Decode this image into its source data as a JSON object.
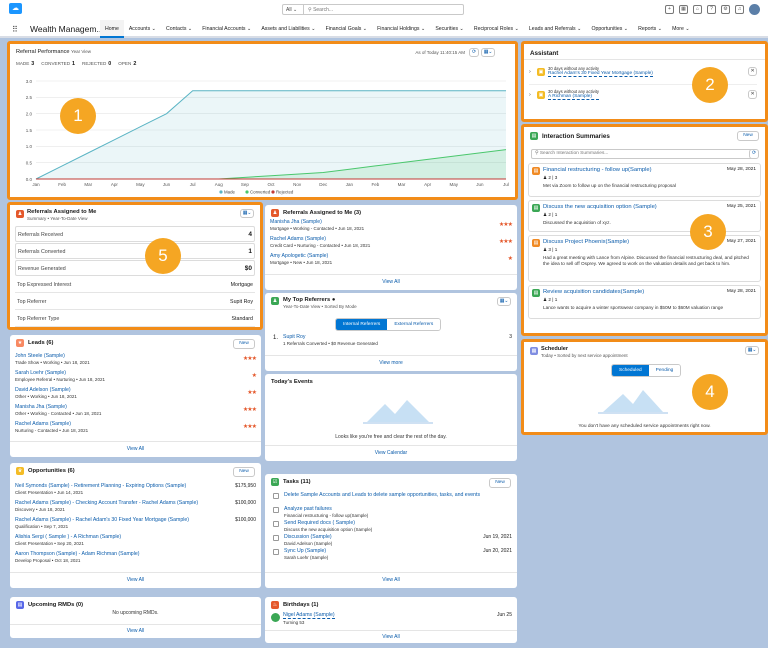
{
  "global_header": {
    "search_scope": "All",
    "search_placeholder": "Search...",
    "logo_glyph": "☁",
    "utility_icons": [
      "+",
      "▦",
      "⌂",
      "?",
      "⚙",
      "♫"
    ]
  },
  "app": {
    "name": "Wealth Managem..."
  },
  "nav": [
    "Home",
    "Accounts",
    "Contacts",
    "Financial Accounts",
    "Assets and Liabilities",
    "Financial Goals",
    "Financial Holdings",
    "Securities",
    "Reciprocal Roles",
    "Leads and Referrals",
    "Opportunities",
    "Reports",
    "More"
  ],
  "referral_performance": {
    "title": "Referral Performance",
    "period": "Year View",
    "as_of": "As of Today 11:40:15 AM",
    "stats": [
      {
        "label": "MADE",
        "value": "3"
      },
      {
        "label": "CONVERTED",
        "value": "1"
      },
      {
        "label": "REJECTED",
        "value": "0"
      },
      {
        "label": "OPEN",
        "value": "2"
      }
    ]
  },
  "chart_data": {
    "type": "area",
    "x": [
      "Jan",
      "Feb",
      "Mar",
      "Apr",
      "May",
      "Jun",
      "Jul",
      "Aug",
      "Sep",
      "Oct",
      "Nov",
      "Dec",
      "Jan",
      "Feb",
      "Mar",
      "Apr",
      "May",
      "Jun",
      "Jul"
    ],
    "y_ticks": [
      "3.0",
      "2.5",
      "2.0",
      "1.5",
      "1.0",
      "0.5",
      "0.0"
    ],
    "ylim": [
      0,
      3
    ],
    "series": [
      {
        "name": "Made",
        "color": "#5ab4c4",
        "values": [
          0,
          0.4,
          0.8,
          1.2,
          1.6,
          2.0,
          2.7,
          2.7,
          2.7,
          2.7,
          2.7,
          2.7,
          2.7,
          2.7,
          2.7,
          2.7,
          2.7,
          2.7,
          2.7
        ]
      },
      {
        "name": "Converted",
        "color": "#4bc76d",
        "values": [
          0,
          0,
          0,
          0,
          0,
          0,
          0,
          0,
          0.05,
          0.1,
          0.15,
          0.2,
          0.3,
          0.4,
          0.5,
          0.6,
          0.7,
          0.8,
          0.9
        ]
      },
      {
        "name": "Rejected",
        "color": "#c23934",
        "values": [
          0,
          0,
          0,
          0,
          0,
          0,
          0,
          0,
          0,
          0,
          0,
          0,
          0,
          0,
          0,
          0,
          0,
          0,
          0
        ]
      }
    ]
  },
  "assistant": {
    "title": "Assistant",
    "items": [
      {
        "meta": "30 days without any activity",
        "link": "Rachel Adam's 30 Fixed Year Mortgage (Sample)"
      },
      {
        "meta": "30 days without any activity",
        "link": "A Richman (Sample)"
      }
    ]
  },
  "interactions": {
    "title": "Interaction Summaries",
    "new_label": "New",
    "search_placeholder": "Search Interaction Summaries...",
    "items": [
      {
        "title": "Financial restructuring - follow up(Sample)",
        "date": "May 28, 2021",
        "counts": "2  |  3",
        "body": "Met via Zoom to follow up on the financial restructuring proposal"
      },
      {
        "title": "Discuss the new acquisition option (Sample)",
        "date": "May 25, 2021",
        "counts": "2  |  1",
        "body": "Discussed the acquisition of xyz."
      },
      {
        "title": "Discuss Project Phoenix(Sample)",
        "date": "May 27, 2021",
        "counts": "3  |  1",
        "body": "Had a great meeting with Lance from Alpine. Discussed the financial restructuring deal, and pitched the idea to sell off Osprey. We agreed to work on the valuation details and get back to him."
      },
      {
        "title": "Review acquisition candidates(Sample)",
        "date": "May 28, 2021",
        "counts": "2  |  1",
        "body": "Lance wants to acquire a winter sportswear company in $50M to $60M valuation range"
      }
    ]
  },
  "scheduler": {
    "title": "Scheduler",
    "sub": "Today  •  Sorted by next service appointment",
    "tabs": [
      "Scheduled",
      "Pending"
    ],
    "empty": "You don't have any scheduled service appointments right now."
  },
  "ref_summary": {
    "title": "Referrals Assigned to Me",
    "sub": "Summary  •  Year-To-Date View",
    "rows": [
      {
        "label": "Referrals Received",
        "value": "4"
      },
      {
        "label": "Referrals Converted",
        "value": "1"
      },
      {
        "label": "Revenue Generated",
        "value": "$0"
      },
      {
        "label": "Top Expressed Interest",
        "value": "Mortgage"
      },
      {
        "label": "Top Referrer",
        "value": "Supit Roy"
      },
      {
        "label": "Top Referrer Type",
        "value": "Standard"
      }
    ]
  },
  "ref_list": {
    "title": "Referrals Assigned to Me (3)",
    "view_all": "View All",
    "items": [
      {
        "name": "Manisha Jha (Sample)",
        "sub": "Mortgage  •  Working - Contacted  •  Jun 18, 2021",
        "stars": "★★★"
      },
      {
        "name": "Rachel Adams (Sample)",
        "sub": "Credit Card  •  Nurturing - Contacted  •  Jun 18, 2021",
        "stars": "★★★"
      },
      {
        "name": "Amy Apologetic (Sample)",
        "sub": "Mortgage  •  New  •  Jun 18, 2021",
        "stars": "★"
      }
    ]
  },
  "leads": {
    "title": "Leads (6)",
    "new_label": "New",
    "view_all": "View All",
    "items": [
      {
        "name": "John Steele (Sample)",
        "sub": "Trade Show  •  Working  •  Jun 18, 2021",
        "stars": "★★★"
      },
      {
        "name": "Sarah Loehr (Sample)",
        "sub": "Employee Referral  •  Nurturing  •  Jun 18, 2021",
        "stars": "★"
      },
      {
        "name": "David Adelson (Sample)",
        "sub": "Other  •  Working  •  Jun 18, 2021",
        "stars": "★★"
      },
      {
        "name": "Manisha Jha (Sample)",
        "sub": "Other  •  Working - Contacted  •  Jun 18, 2021",
        "stars": "★★★"
      },
      {
        "name": "Rachel Adams (Sample)",
        "sub": "Nurturing - Contacted  •  Jun 18, 2021",
        "stars": "★★★"
      }
    ]
  },
  "top_referrers": {
    "title": "My Top Referrers",
    "sub": "Year-To-Date View  •  Sorted By Mode",
    "tabs": [
      "Internal Referrers",
      "External Referrers"
    ],
    "item": {
      "rank": "1.",
      "name": "Supit Roy",
      "sub": "1 Referrals Converted  •  $0 Revenue Generated",
      "count": "3"
    },
    "view_more": "View more"
  },
  "events": {
    "title": "Today's Events",
    "empty": "Looks like you're free and clear the rest of the day.",
    "view_calendar": "View Calendar"
  },
  "opportunities": {
    "title": "Opportunities (6)",
    "new_label": "New",
    "view_all": "View All",
    "items": [
      {
        "name": "Neil Symonds (Sample) - Retirement Planning - Expiring Options (Sample)",
        "sub": "Client Presentation  •  Jun 14, 2021",
        "value": "$175,950"
      },
      {
        "name": "Rachel Adams (Sample) - Checking Account Transfer - Rachel Adams (Sample)",
        "sub": "Discovery  •  Jun 18, 2021",
        "value": "$100,000"
      },
      {
        "name": "Rachel Adams (Sample) - Rachel Adam's 30 Fixed Year Mortgage (Sample)",
        "sub": "Qualification  •  Sep 7, 2021",
        "value": "$100,000"
      },
      {
        "name": "Alishia Sergi ( Sample ) - A Richman (Sample)",
        "sub": "Client Presentation  •  Sep 20, 2021",
        "value": ""
      },
      {
        "name": "Aaron Thompson (Sample) - Adam Richman (Sample)",
        "sub": "Develop Proposal  •  Oct 18, 2021",
        "value": ""
      }
    ]
  },
  "tasks": {
    "title": "Tasks (11)",
    "new_label": "New",
    "view_all": "View All",
    "items": [
      {
        "name": "Delete Sample Accounts and Leads to delete sample opportunities, tasks, and events",
        "sub": "",
        "date": ""
      },
      {
        "name": "Analyze past failures",
        "sub": "Financial restructuring - follow up(Sample)",
        "date": ""
      },
      {
        "name": "Send Required docs ( Sample)",
        "sub": "Discuss the new acquisition option (Sample)",
        "date": ""
      },
      {
        "name": "Discussion (Sample)",
        "sub": "David Adelson (Sample)",
        "date": "Jun 19, 2021"
      },
      {
        "name": "Sync Up (Sample)",
        "sub": "Sarah Loehr (Sample)",
        "date": "Jun 20, 2021"
      }
    ]
  },
  "rmds": {
    "title": "Upcoming RMDs (0)",
    "empty": "No upcoming RMDs.",
    "view_all": "View All"
  },
  "birthdays": {
    "title": "Birthdays (1)",
    "view_all": "View All",
    "item": {
      "name": "Nigel Adams (Sample)",
      "sub": "Turning 53",
      "date": "Jun 25"
    }
  },
  "callouts": [
    "1",
    "2",
    "3",
    "4",
    "5"
  ]
}
